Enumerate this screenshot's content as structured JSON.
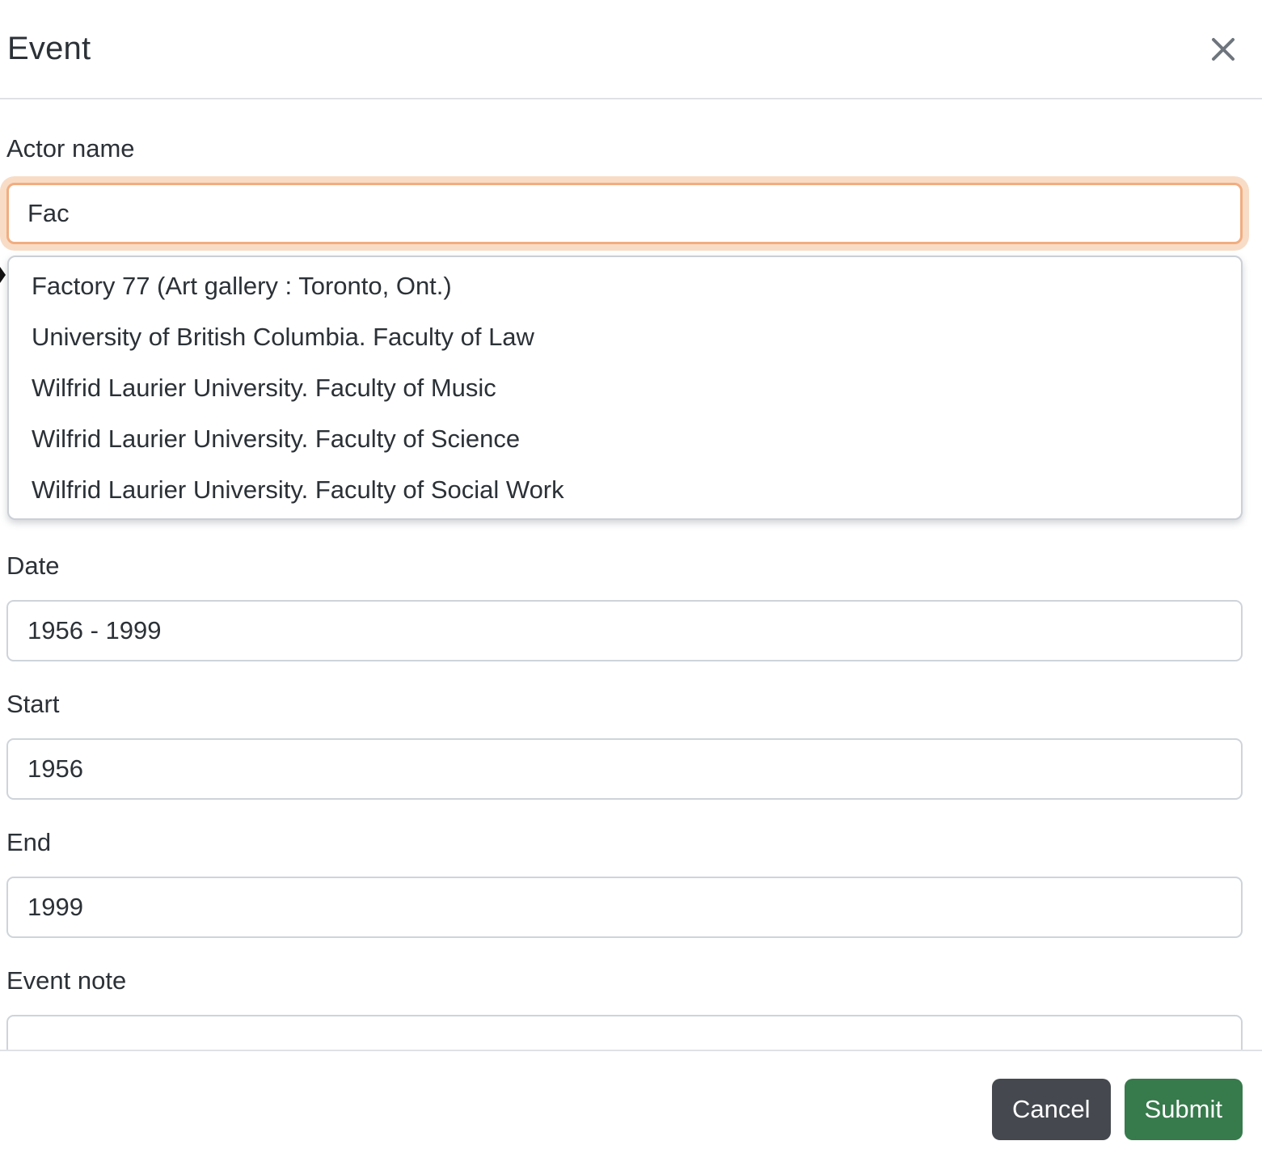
{
  "modal": {
    "title": "Event"
  },
  "form": {
    "actor_name": {
      "label": "Actor name",
      "value": "Fac"
    },
    "autocomplete_items": [
      "Factory 77 (Art gallery : Toronto, Ont.)",
      "University of British Columbia. Faculty of Law",
      "Wilfrid Laurier University. Faculty of Music",
      "Wilfrid Laurier University. Faculty of Science",
      "Wilfrid Laurier University. Faculty of Social Work"
    ],
    "date": {
      "label": "Date",
      "value": "1956 - 1999"
    },
    "start": {
      "label": "Start",
      "value": "1956"
    },
    "end": {
      "label": "End",
      "value": "1999"
    },
    "event_note": {
      "label": "Event note",
      "value": ""
    }
  },
  "footer": {
    "cancel_label": "Cancel",
    "submit_label": "Submit"
  },
  "colors": {
    "focus_border": "#f1ad80",
    "focus_ring": "#f8dcc6",
    "cancel_bg": "#45494f",
    "submit_bg": "#377a4c",
    "divider": "#dee2e6",
    "input_border": "#ced4da"
  }
}
